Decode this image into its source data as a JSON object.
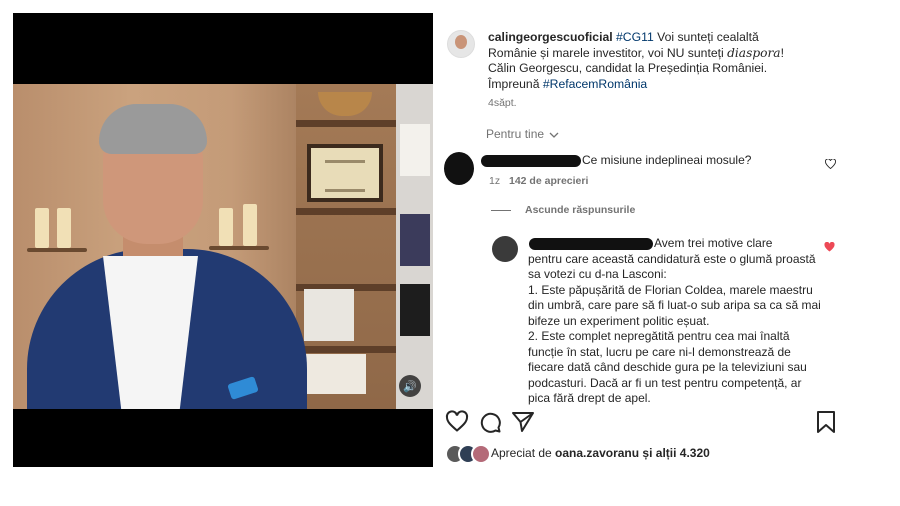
{
  "post": {
    "username": "calingeorgescuoficial",
    "caption_tag1": "#CG11",
    "caption_part1": "Voi sunteți cealaltă Românie și marele investitor, voi NU sunteți",
    "caption_italic": "diaspora",
    "caption_excl": "!",
    "caption_line2": "Călin Georgescu, candidat la Președinția României.",
    "caption_together": "Împreună",
    "caption_tag2": "#RefacemRomânia",
    "age": "4săpt."
  },
  "filter": {
    "label": "Pentru tine",
    "chevron_icon": "chevron-down-icon"
  },
  "comments": [
    {
      "text": "Ce misiune indeplineai mosule?",
      "age": "1z",
      "likes": "142 de aprecieri",
      "heart_icon": "heart-outline-icon"
    }
  ],
  "hide_replies": "Ascunde răspunsurile",
  "reply": {
    "lines": [
      "Avem trei motive clare",
      "pentru care această candidatură este o glumă proastă",
      "sa votezi cu d-na Lasconi:",
      "1. Este păpușărită de Florian Coldea, marele maestru",
      "din umbră, care pare să fi luat-o sub aripa sa ca să mai",
      "bifeze un experiment politic eșuat.",
      "2. Este complet nepregătită pentru cea mai înaltă",
      "funcție în stat, lucru pe care ni-l demonstrează de",
      "fiecare dată când deschide gura pe la televiziuni sau",
      "podcasturi. Dacă ar fi un test pentru competență, ar",
      "pica fără drept de apel."
    ],
    "heart_icon": "heart-filled-icon",
    "heart_color": "#ed4956"
  },
  "actions": {
    "like_icon": "heart-icon",
    "comment_icon": "comment-icon",
    "share_icon": "send-icon",
    "save_icon": "bookmark-icon"
  },
  "likes_line": {
    "prefix": "Apreciat de",
    "user": "oana.zavoranu",
    "suffix": "și alții 4.320"
  },
  "video": {
    "volume_icon": "speaker-icon"
  },
  "colors": {
    "link": "#00376b",
    "muted": "#737373",
    "text": "#262626"
  }
}
